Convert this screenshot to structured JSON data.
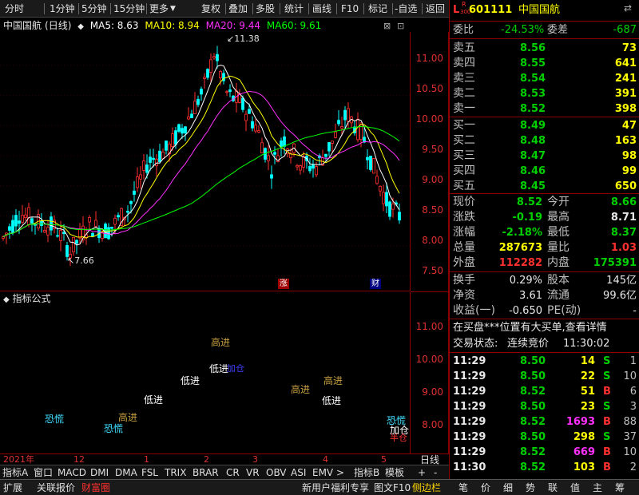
{
  "toolbar": {
    "left_items": [
      "分时",
      "1分钟",
      "5分钟",
      "15分钟",
      "更多"
    ],
    "right_items": [
      "复权",
      "叠加",
      "多股",
      "统计",
      "画线",
      "F10",
      "标记",
      "-自选",
      "返回"
    ]
  },
  "chart_header": {
    "stock_name": "中国国航",
    "period": "(日线)",
    "ma5": "MA5: 8.63",
    "ma10": "MA10: 8.94",
    "ma20": "MA20: 9.44",
    "ma60": "MA60: 9.61",
    "ma5_color": "#ffffff",
    "ma10_color": "#ffff00",
    "ma20_color": "#ff30ff",
    "ma60_color": "#00ff00"
  },
  "main_axis": {
    "ticks": [
      "11.00",
      "10.50",
      "10.00",
      "9.50",
      "9.00",
      "8.50",
      "8.00",
      "7.50"
    ]
  },
  "annotations": {
    "high_label": "11.38",
    "low_label": "7.66",
    "badge_zhang": "涨",
    "badge_cai": "财"
  },
  "indicator": {
    "title": "指标公式",
    "ticks": [
      "11.00",
      "10.00",
      "9.00",
      "8.00"
    ],
    "labels": [
      {
        "text": "高进",
        "color": "#c8a040"
      },
      {
        "text": "低进",
        "color": "#ffffff"
      },
      {
        "text": "低进",
        "color": "#ffffff"
      },
      {
        "text": "高进",
        "color": "#c8a040"
      },
      {
        "text": "高进",
        "color": "#c8a040"
      },
      {
        "text": "低进",
        "color": "#ffffff"
      },
      {
        "text": "恐慌",
        "color": "#40e0ff"
      },
      {
        "text": "恐慌",
        "color": "#40e0ff"
      },
      {
        "text": "高进",
        "color": "#c8a040"
      },
      {
        "text": "恐慌",
        "color": "#40e0ff"
      },
      {
        "text": "加仓",
        "color": "#ffffff"
      },
      {
        "text": "半仓",
        "color": "#ff3030"
      },
      {
        "text": "低进",
        "color": "#ffffff"
      },
      {
        "text": "加仓",
        "color": "#4040ff"
      }
    ]
  },
  "x_axis": {
    "labels": [
      "2021年",
      "12",
      "1",
      "2",
      "3",
      "4",
      "5"
    ],
    "period_btn": "日线"
  },
  "bottom_tabs": [
    "指标A",
    "窗口",
    "MACD",
    "DMI",
    "DMA",
    "FSL",
    "TRIX",
    "BRAR",
    "CR",
    "VR",
    "OBV",
    "ASI",
    "EMV",
    ">",
    "指标B",
    "模板",
    "+",
    "-"
  ],
  "status_bar": {
    "left": [
      "扩展",
      "关联报价",
      "财富圈"
    ],
    "middle": [
      "新用户福利专享",
      "图文F10",
      "侧边栏"
    ],
    "right": [
      "笔",
      "价",
      "细",
      "势",
      "联",
      "值",
      "主",
      "筹"
    ]
  },
  "quote": {
    "code": "601111",
    "name": "中国国航",
    "market_badge_top": "R",
    "market_badge_bottom": "300",
    "market_letter": "L",
    "weibi_label": "委比",
    "weibi_value": "-24.53%",
    "weicha_label": "委差",
    "weicha_value": "-687",
    "asks": [
      {
        "label": "卖五",
        "price": "8.56",
        "vol": "73"
      },
      {
        "label": "卖四",
        "price": "8.55",
        "vol": "641"
      },
      {
        "label": "卖三",
        "price": "8.54",
        "vol": "241"
      },
      {
        "label": "卖二",
        "price": "8.53",
        "vol": "391"
      },
      {
        "label": "卖一",
        "price": "8.52",
        "vol": "398"
      }
    ],
    "bids": [
      {
        "label": "买一",
        "price": "8.49",
        "vol": "47"
      },
      {
        "label": "买二",
        "price": "8.48",
        "vol": "163"
      },
      {
        "label": "买三",
        "price": "8.47",
        "vol": "98"
      },
      {
        "label": "买四",
        "price": "8.46",
        "vol": "99"
      },
      {
        "label": "买五",
        "price": "8.45",
        "vol": "650"
      }
    ],
    "stats": [
      {
        "l1": "现价",
        "v1": "8.52",
        "c1": "green",
        "l2": "今开",
        "v2": "8.66",
        "c2": "green"
      },
      {
        "l1": "涨跌",
        "v1": "-0.19",
        "c1": "green",
        "l2": "最高",
        "v2": "8.71",
        "c2": "white"
      },
      {
        "l1": "涨幅",
        "v1": "-2.18%",
        "c1": "green",
        "l2": "最低",
        "v2": "8.37",
        "c2": "green"
      },
      {
        "l1": "总量",
        "v1": "287673",
        "c1": "yellow",
        "l2": "量比",
        "v2": "1.03",
        "c2": "red"
      },
      {
        "l1": "外盘",
        "v1": "112282",
        "c1": "red",
        "l2": "内盘",
        "v2": "175391",
        "c2": "green"
      }
    ],
    "stats2": [
      {
        "l1": "换手",
        "v1": "0.29%",
        "l2": "股本",
        "v2": "145亿"
      },
      {
        "l1": "净资",
        "v1": "3.61",
        "l2": "流通",
        "v2": "99.6亿"
      },
      {
        "l1": "收益(一)",
        "v1": "-0.650",
        "l2": "PE(动)",
        "v2": "-"
      }
    ],
    "news": "在买盘***位置有大买单,查看详情",
    "trade_status_label": "交易状态:",
    "trade_status": "连续竞价",
    "trade_time": "11:30:02",
    "ticks": [
      {
        "time": "11:29",
        "price": "8.50",
        "vol": "14",
        "vc": "yellow",
        "side": "S",
        "sc": "green",
        "n": "1"
      },
      {
        "time": "11:29",
        "price": "8.50",
        "vol": "22",
        "vc": "yellow",
        "side": "S",
        "sc": "green",
        "n": "10"
      },
      {
        "time": "11:29",
        "price": "8.52",
        "vol": "51",
        "vc": "yellow",
        "side": "B",
        "sc": "red",
        "n": "6"
      },
      {
        "time": "11:29",
        "price": "8.50",
        "vol": "23",
        "vc": "yellow",
        "side": "S",
        "sc": "green",
        "n": "3"
      },
      {
        "time": "11:29",
        "price": "8.52",
        "vol": "1693",
        "vc": "magenta",
        "side": "B",
        "sc": "red",
        "n": "88"
      },
      {
        "time": "11:29",
        "price": "8.50",
        "vol": "298",
        "vc": "yellow",
        "side": "S",
        "sc": "green",
        "n": "37"
      },
      {
        "time": "11:29",
        "price": "8.52",
        "vol": "669",
        "vc": "magenta",
        "side": "B",
        "sc": "red",
        "n": "10"
      },
      {
        "time": "11:30",
        "price": "8.52",
        "vol": "103",
        "vc": "yellow",
        "side": "B",
        "sc": "red",
        "n": "2"
      }
    ]
  },
  "colors": {
    "up": "#ff3030",
    "down": "#00ffff",
    "grid": "#8b0000"
  }
}
